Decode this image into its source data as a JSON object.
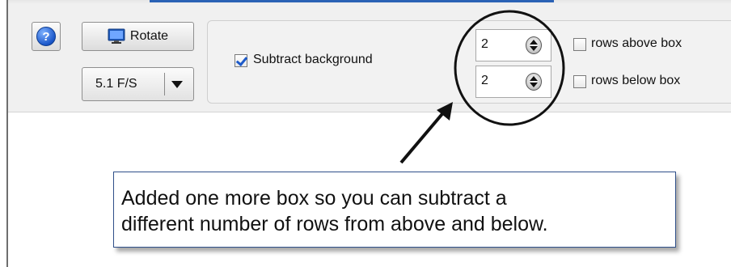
{
  "toolbar": {
    "help_icon": "help-question-icon",
    "help_glyph": "?",
    "rotate": {
      "label": "Rotate",
      "icon": "monitor-icon"
    },
    "fps": {
      "value": "5.1 F/S",
      "icon": "dropdown-arrow-icon"
    }
  },
  "settings": {
    "subtract_background": {
      "label": "Subtract background",
      "checked": true
    },
    "rows_above": {
      "value": "2",
      "label": "rows above box",
      "checked": false
    },
    "rows_below": {
      "value": "2",
      "label": "rows below box",
      "checked": false
    }
  },
  "annotation": {
    "lines": [
      "Added one more box so you can subtract a",
      "different number of rows from above and below."
    ]
  },
  "colors": {
    "accent": "#2b62b5",
    "checkmark": "#1d5ac9",
    "callout_border": "#2f4f89",
    "toolbar_bg": "#f0f0f0"
  }
}
